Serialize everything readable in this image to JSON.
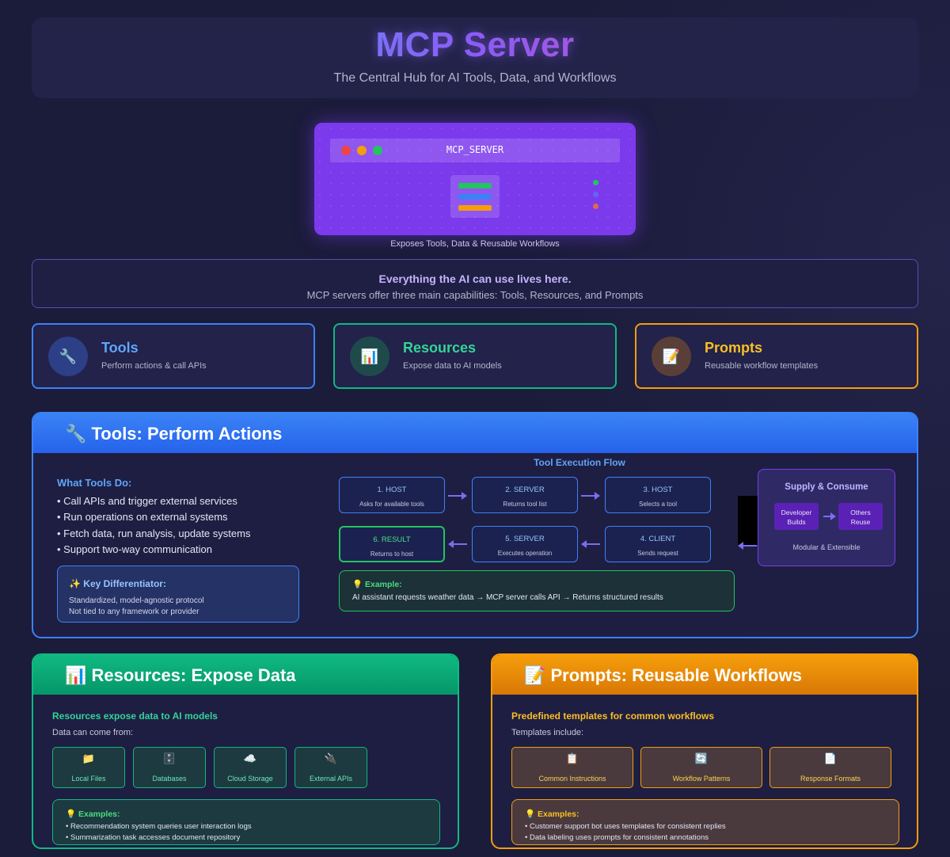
{
  "header": {
    "title": "MCP Server",
    "subtitle": "The Central Hub for AI Tools, Data, and Workflows"
  },
  "server": {
    "name": "MCP_SERVER",
    "caption": "Exposes Tools, Data & Reusable Workflows"
  },
  "banner": {
    "headline": "Everything the AI can use lives here.",
    "text": "MCP servers offer three main capabilities: Tools, Resources, and Prompts"
  },
  "capabilities": [
    {
      "icon": "🔧",
      "title": "Tools",
      "desc": "Perform actions & call APIs",
      "color": "#3b82f6"
    },
    {
      "icon": "📊",
      "title": "Resources",
      "desc": "Expose data to AI models",
      "color": "#10b981"
    },
    {
      "icon": "📝",
      "title": "Prompts",
      "desc": "Reusable workflow templates",
      "color": "#f59e0b"
    }
  ],
  "tools": {
    "title": "🔧 Tools: Perform Actions",
    "what_heading": "What Tools Do:",
    "items": [
      "• Call APIs and trigger external services",
      "• Run operations on external systems",
      "• Fetch data, run analysis, update systems",
      "• Support two-way communication"
    ],
    "differentiator": {
      "heading": "✨ Key Differentiator:",
      "lines": [
        "Standardized, model-agnostic protocol",
        "Not tied to any framework or provider"
      ]
    },
    "flow_title": "Tool Execution Flow",
    "steps": [
      {
        "title": "1. HOST",
        "desc": "Asks for available tools"
      },
      {
        "title": "2. SERVER",
        "desc": "Returns tool list"
      },
      {
        "title": "3. HOST",
        "desc": "Selects a tool"
      },
      {
        "title": "4. CLIENT",
        "desc": "Sends request"
      },
      {
        "title": "5. SERVER",
        "desc": "Executes operation"
      },
      {
        "title": "6. RESULT",
        "desc": "Returns to host"
      }
    ],
    "example": {
      "heading": "💡 Example:",
      "text": "AI assistant requests weather data → MCP server calls API → Returns structured results"
    },
    "supply": {
      "heading": "Supply & Consume",
      "left": [
        "Developer",
        "Builds"
      ],
      "right": [
        "Others",
        "Reuse"
      ],
      "footer": "Modular & Extensible"
    }
  },
  "resources": {
    "title": "📊 Resources: Expose Data",
    "subheading": "Resources expose data to AI models",
    "intro": "Data can come from:",
    "sources": [
      {
        "icon": "📁",
        "label": "Local Files"
      },
      {
        "icon": "🗄️",
        "label": "Databases"
      },
      {
        "icon": "☁️",
        "label": "Cloud Storage"
      },
      {
        "icon": "🔌",
        "label": "External APIs"
      }
    ],
    "examples_heading": "💡 Examples:",
    "examples": [
      "• Recommendation system queries user interaction logs",
      "• Summarization task accesses document repository"
    ]
  },
  "prompts": {
    "title": "📝 Prompts: Reusable Workflows",
    "subheading": "Predefined templates for common workflows",
    "intro": "Templates include:",
    "templates": [
      {
        "icon": "📋",
        "label": "Common Instructions"
      },
      {
        "icon": "🔄",
        "label": "Workflow Patterns"
      },
      {
        "icon": "📄",
        "label": "Response Formats"
      }
    ],
    "examples_heading": "💡 Examples:",
    "examples": [
      "• Customer support bot uses templates for consistent replies",
      "• Data labeling uses prompts for consistent annotations"
    ]
  }
}
